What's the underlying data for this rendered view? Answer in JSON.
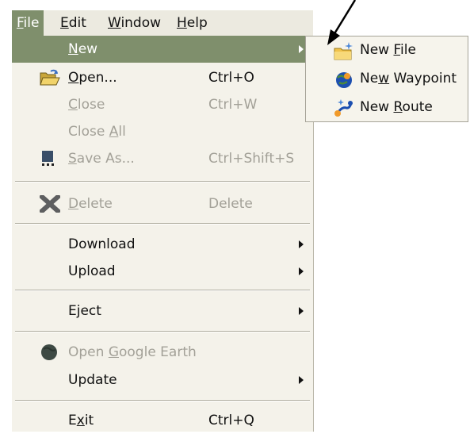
{
  "menubar": {
    "items": [
      {
        "label": "File",
        "mnemonic": "F",
        "rest": "ile",
        "active": true
      },
      {
        "label": "Edit",
        "mnemonic": "E",
        "rest": "dit",
        "active": false
      },
      {
        "label": "Window",
        "mnemonic": "W",
        "rest": "indow",
        "active": false
      },
      {
        "label": "Help",
        "mnemonic": "H",
        "rest": "elp",
        "active": false
      }
    ]
  },
  "file_menu": {
    "new": {
      "label": "New",
      "pre": "",
      "mn": "N",
      "post": "ew",
      "state": "highlighted",
      "has_submenu": true
    },
    "open": {
      "label": "Open...",
      "pre": "",
      "mn": "O",
      "post": "pen...",
      "shortcut": "Ctrl+O",
      "icon": "open-folder-icon"
    },
    "close": {
      "label": "Close",
      "pre": "",
      "mn": "C",
      "post": "lose",
      "shortcut": "Ctrl+W",
      "disabled": true
    },
    "close_all": {
      "label": "Close All",
      "pre": "Close ",
      "mn": "A",
      "post": "ll",
      "disabled": true
    },
    "save_as": {
      "label": "Save As...",
      "pre": "",
      "mn": "S",
      "post": "ave As...",
      "shortcut": "Ctrl+Shift+S",
      "disabled": true,
      "icon": "save-disk-icon"
    },
    "delete": {
      "label": "Delete",
      "pre": "",
      "mn": "D",
      "post": "elete",
      "shortcut": "Delete",
      "disabled": true,
      "icon": "delete-x-icon"
    },
    "download": {
      "label": "Download",
      "has_submenu": true
    },
    "upload": {
      "label": "Upload",
      "has_submenu": true
    },
    "eject": {
      "label": "Eject",
      "has_submenu": true
    },
    "open_google_earth": {
      "label": "Open Google Earth",
      "pre": "Open ",
      "mn": "G",
      "post": "oogle Earth",
      "disabled": true,
      "icon": "google-earth-icon"
    },
    "update": {
      "label": "Update",
      "has_submenu": true
    },
    "exit": {
      "label": "Exit",
      "pre": "E",
      "mn": "x",
      "post": "it",
      "shortcut": "Ctrl+Q"
    }
  },
  "submenu": {
    "new_file": {
      "label": "New File",
      "pre": "New ",
      "mn": "F",
      "post": "ile",
      "icon": "new-file-folder-icon"
    },
    "new_waypoint": {
      "label": "New Waypoint",
      "pre": "Ne",
      "mn": "w",
      "post": " Waypoint",
      "icon": "new-waypoint-globe-icon"
    },
    "new_route": {
      "label": "New Route",
      "pre": "New ",
      "mn": "R",
      "post": "oute",
      "icon": "new-route-icon"
    }
  },
  "colors": {
    "menu_bg": "#f4f2ea",
    "highlight": "#7f8f6c",
    "disabled_text": "#a3a198"
  }
}
